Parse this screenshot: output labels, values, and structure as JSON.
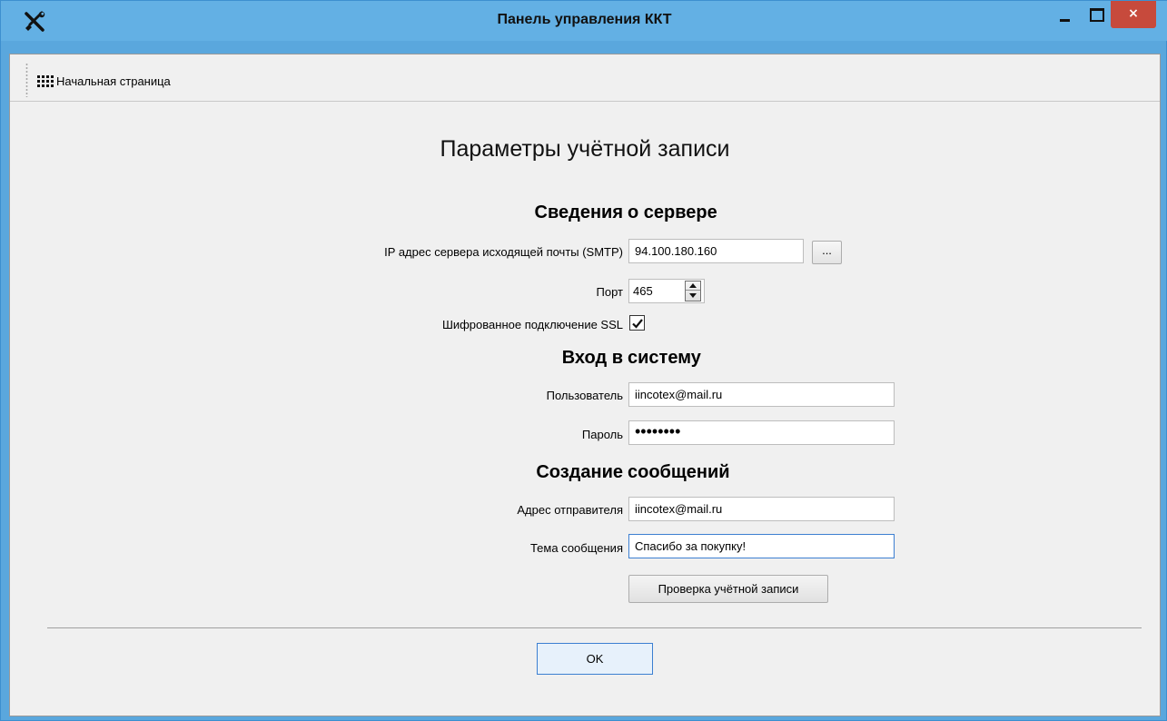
{
  "window": {
    "title": "Панель управления ККТ",
    "close_label": "×"
  },
  "toolbar": {
    "home_label": "Начальная страница"
  },
  "page": {
    "title": "Параметры учётной записи"
  },
  "server_section": {
    "title_left": "Сведения",
    "title_right": "о сервере",
    "smtp_label": "IP адрес сервера исходящей почты (SMTP)",
    "smtp_value": "94.100.180.160",
    "browse_label": "...",
    "port_label": "Порт",
    "port_value": "465",
    "ssl_label": "Шифрованное подключение SSL",
    "ssl_checked": true
  },
  "login_section": {
    "title_left": "Вход в",
    "title_right": "систему",
    "user_label": "Пользователь",
    "user_value": "iincotex@mail.ru",
    "password_label": "Пароль",
    "password_value": "••••••••"
  },
  "message_section": {
    "title_left": "Создание",
    "title_right": "сообщений",
    "sender_label": "Адрес отправителя",
    "sender_value": "iincotex@mail.ru",
    "subject_label": "Тема сообщения",
    "subject_value": "Спасибо за покупку!",
    "check_button_label": "Проверка учётной записи"
  },
  "footer": {
    "ok_label": "OK"
  },
  "colors": {
    "titlebar": "#63b0e4",
    "close_button": "#c74a3c",
    "focus_border": "#3c7fd1"
  }
}
